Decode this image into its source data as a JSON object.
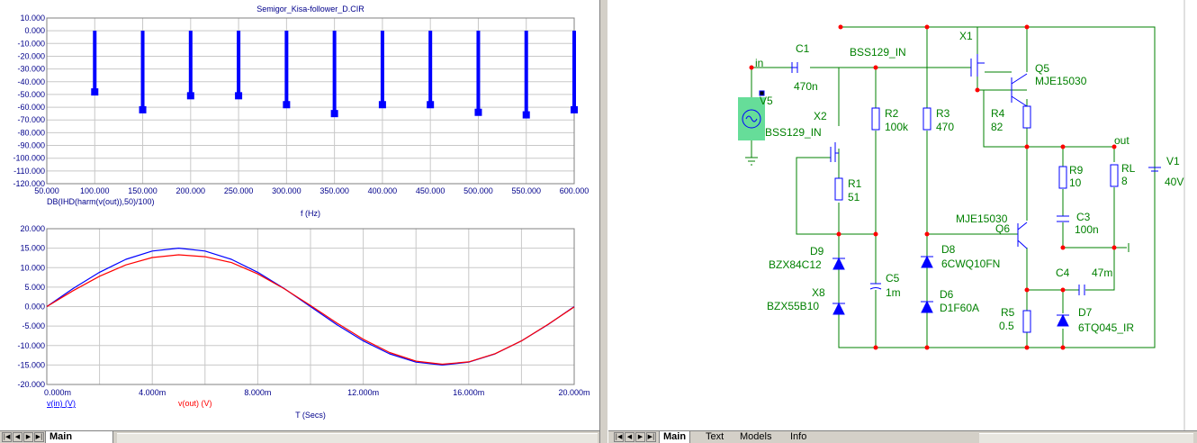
{
  "analysis": {
    "title": "Semigor_Kisa-follower_D.CIR",
    "colors": {
      "axis": "#00008b",
      "grid": "#c8c8c8",
      "trace_in": "#0000ff",
      "trace_out": "#ff0000"
    }
  },
  "chart_data": [
    {
      "type": "bar",
      "title": "Semigor_Kisa-follower_D.CIR",
      "xlabel": "f (Hz)",
      "ylabel": "",
      "x": [
        100,
        150,
        200,
        250,
        300,
        350,
        400,
        450,
        500,
        550,
        600
      ],
      "series": [
        {
          "name": "DB(IHD(harm(v(out)),50)/100)",
          "values": [
            -48,
            -62,
            -51,
            -51,
            -58,
            -65,
            -58,
            -58,
            -64,
            -66,
            -62
          ]
        }
      ],
      "xlim": [
        50,
        600
      ],
      "ylim": [
        -120,
        10
      ],
      "xticks": [
        "50.000",
        "100.000",
        "150.000",
        "200.000",
        "250.000",
        "300.000",
        "350.000",
        "400.000",
        "450.000",
        "500.000",
        "550.000",
        "600.000"
      ],
      "yticks": [
        "10.000",
        "0.000",
        "-10.000",
        "-20.000",
        "-30.000",
        "-40.000",
        "-50.000",
        "-60.000",
        "-70.000",
        "-80.000",
        "-90.000",
        "-100.000",
        "-110.000",
        "-120.000"
      ],
      "grid": true
    },
    {
      "type": "line",
      "title": "",
      "xlabel": "T (Secs)",
      "ylabel": "",
      "x": [
        0,
        1,
        2,
        3,
        4,
        5,
        6,
        7,
        8,
        9,
        10,
        11,
        12,
        13,
        14,
        15,
        16,
        17,
        18,
        19,
        20
      ],
      "series": [
        {
          "name": "v(in) (V)",
          "values": [
            0.0,
            4.64,
            8.82,
            12.14,
            14.27,
            15.0,
            14.27,
            12.14,
            8.82,
            4.64,
            0.0,
            -4.64,
            -8.82,
            -12.14,
            -14.27,
            -15.0,
            -14.27,
            -12.14,
            -8.82,
            -4.64,
            0.0
          ]
        },
        {
          "name": "v(out) (V)",
          "values": [
            0.0,
            4.1,
            7.8,
            10.7,
            12.6,
            13.3,
            12.8,
            11.3,
            8.4,
            4.6,
            0.3,
            -4.2,
            -8.4,
            -11.8,
            -14.0,
            -14.8,
            -14.2,
            -12.1,
            -8.8,
            -4.6,
            -0.1
          ]
        }
      ],
      "xlim": [
        0,
        20
      ],
      "ylim": [
        -20,
        20
      ],
      "xticks": [
        "0.000m",
        "4.000m",
        "8.000m",
        "12.000m",
        "16.000m",
        "20.000m"
      ],
      "yticks": [
        "20.000",
        "15.000",
        "10.000",
        "5.000",
        "0.000",
        "-5.000",
        "-10.000",
        "-15.000",
        "-20.000"
      ],
      "grid": true
    }
  ],
  "schematic": {
    "labels": {
      "in": "in",
      "out": "out",
      "C1": "C1",
      "C1v": "470n",
      "X1": "X1",
      "X1m": "BSS129_IN",
      "X2": "X2",
      "X2m": "BSS129_IN",
      "V5": "V5",
      "R1": "R1",
      "R1v": "51",
      "R2": "R2",
      "R2v": "100k",
      "R3": "R3",
      "R3v": "470",
      "R4": "R4",
      "R4v": "82",
      "Q5": "Q5",
      "Q5m": "MJE15030",
      "Q6": "Q6",
      "Q6m": "MJE15030",
      "R9": "R9",
      "R9v": "10",
      "RL": "RL",
      "RLv": "8",
      "V1": "V1",
      "V1v": "40V",
      "C3": "C3",
      "C3v": "100n",
      "C4": "C4",
      "C4v": "47m",
      "C5": "C5",
      "C5v": "1m",
      "D9": "D9",
      "D9m": "BZX84C12",
      "X8": "X8",
      "X8m": "BZX55B10",
      "D8": "D8",
      "D8m": "6CWQ10FN",
      "D6": "D6",
      "D6m": "D1F60A",
      "D7": "D7",
      "D7m": "6TQ045_IR",
      "R5": "R5",
      "R5v": "0.5"
    },
    "colors": {
      "wire": "#008000",
      "part": "#0000ff",
      "node": "#ff0000",
      "label": "#008000",
      "source_bg": "#66dd99"
    }
  },
  "left_tabs": {
    "nav": [
      "|◀",
      "◀",
      "▶",
      "▶|"
    ],
    "tabs": [
      "Main"
    ]
  },
  "right_tabs": {
    "nav": [
      "|◀",
      "◀",
      "▶",
      "▶|"
    ],
    "tabs": [
      "Main",
      "Text",
      "Models",
      "Info"
    ]
  }
}
